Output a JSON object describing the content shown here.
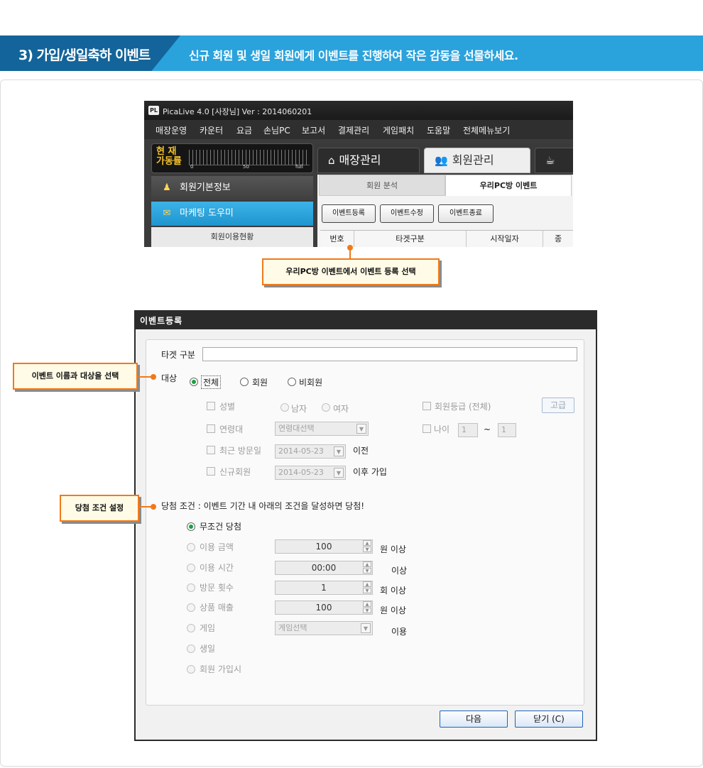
{
  "header": {
    "title": "3) 가입/생일축하 이벤트",
    "subtitle": "신규 회원 및 생일 회원에게 이벤트를 진행하여 작은 감동을 선물하세요."
  },
  "app": {
    "logo": "PL",
    "title": "PicaLive 4.0 [사장님] Ver : 2014060201",
    "menu": [
      "매장운영",
      "카운터",
      "요금",
      "손님PC",
      "보고서",
      "결제관리",
      "게임패치",
      "도움말",
      "전체메뉴보기"
    ],
    "gauge": {
      "label1": "현 재",
      "label2": "가동률",
      "min": "0",
      "mid": "50",
      "max": "full"
    },
    "main_tabs": [
      {
        "label": "매장관리",
        "icon": "home-icon"
      },
      {
        "label": "회원관리",
        "icon": "members-icon"
      }
    ],
    "sidebar": [
      {
        "label": "회원기본정보",
        "icon": "member-info-icon"
      },
      {
        "label": "마케팅 도우미",
        "icon": "marketing-icon"
      }
    ],
    "sidebar_sub": "회원이용현황",
    "sub_tabs": [
      "회원 분석",
      "우리PC방 이벤트"
    ],
    "buttons": [
      "이벤트등록",
      "이벤트수정",
      "이벤트종료"
    ],
    "table_headers": [
      "번호",
      "타겟구분",
      "시작일자",
      "종"
    ]
  },
  "callouts": {
    "register": "우리PC방 이벤트에서 이벤트 등록 선택",
    "target": "이벤트 이름과 대상을 선택",
    "condition": "당첨 조건 설정"
  },
  "dialog": {
    "title": "이벤트등록",
    "target_label": "타겟 구분",
    "target_value": "",
    "audience_label": "대상",
    "audience_options": [
      "전체",
      "회원",
      "비회원"
    ],
    "audience_selected": "전체",
    "filters": {
      "gender": "성별",
      "gender_options": [
        "남자",
        "여자"
      ],
      "member_grade": "회원등급 (전체)",
      "advanced_button": "고급",
      "age_group": "연령대",
      "age_select": "연령대선택",
      "age": "나이",
      "age_from": "1",
      "tilde": "~",
      "age_to": "1",
      "recent_visit": "최근 방문일",
      "recent_date": "2014-05-23",
      "recent_suffix": "이전",
      "new_member": "신규회원",
      "new_date": "2014-05-23",
      "new_suffix": "이후 가입"
    },
    "win_condition_label": "당첨 조건 : 이벤트 기간 내 아래의 조건을 달성하면 당첨!",
    "conditions": [
      {
        "label": "무조건 당첨",
        "selected": true
      },
      {
        "label": "이용 금액",
        "value": "100",
        "suffix": "원 이상"
      },
      {
        "label": "이용 시간",
        "value": "00:00",
        "suffix": "이상"
      },
      {
        "label": "방문 횟수",
        "value": "1",
        "suffix": "회 이상"
      },
      {
        "label": "상품 매출",
        "value": "100",
        "suffix": "원 이상"
      },
      {
        "label": "게임",
        "select": "게임선택",
        "suffix": "이용"
      },
      {
        "label": "생일"
      },
      {
        "label": "회원 가입시"
      }
    ],
    "next_button": "다음",
    "close_button": "닫기 (C)"
  },
  "colors": {
    "banner": "#2aa2dc",
    "banner_title": "#13649a",
    "callout_border": "#f07a1a",
    "selected_radio": "#1aa13f",
    "sidebar_active": "#2aa2dc"
  }
}
